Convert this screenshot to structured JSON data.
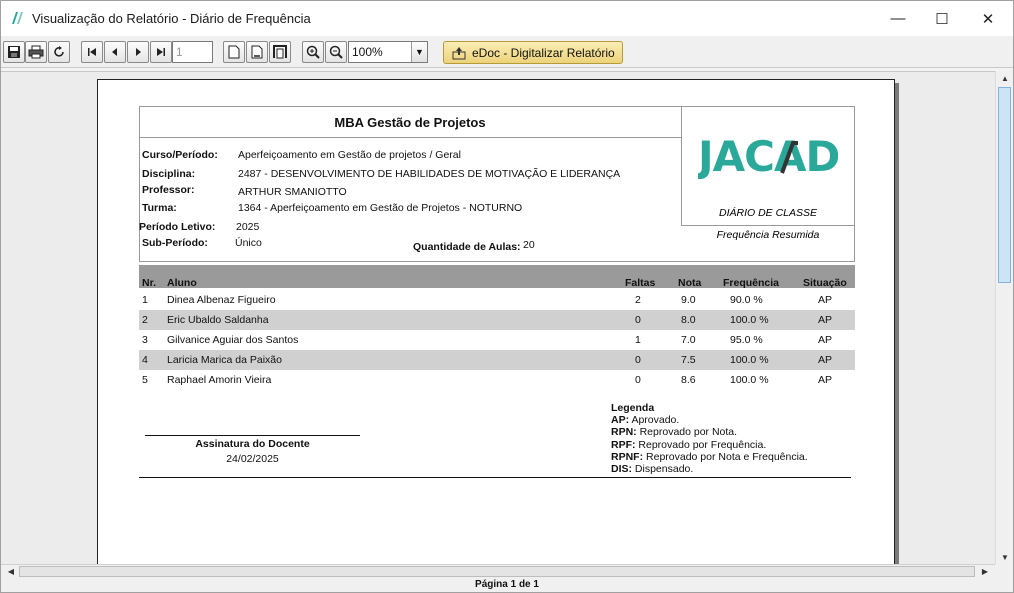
{
  "window": {
    "title": "Visualização do Relatório - Diário de Frequência",
    "min_glyph": "—",
    "max_glyph": "☐",
    "close_glyph": "✕"
  },
  "toolbar": {
    "page_value": "1",
    "zoom_value": "100%",
    "edoc_label": "eDoc - Digitalizar Relatório"
  },
  "report": {
    "course_title": "MBA Gestão de Projetos",
    "logo_text": "JACAD",
    "diario_label": "DIÁRIO DE CLASSE",
    "resumida_label": "Frequência Resumida",
    "fields": {
      "curso_label": "Curso/Período:",
      "curso_value": "Aperfeiçoamento em Gestão de projetos / Geral",
      "disciplina_label": "Disciplina:",
      "disciplina_value": "2487 - DESENVOLVIMENTO DE HABILIDADES DE MOTIVAÇÃO E LIDERANÇA",
      "professor_label": "Professor:",
      "professor_value": "ARTHUR SMANIOTTO",
      "turma_label": "Turma:",
      "turma_value": "1364 - Aperfeiçoamento em Gestão de Projetos - NOTURNO",
      "periodo_label": "Período Letivo:",
      "periodo_value": "2025",
      "subperiodo_label": "Sub-Período:",
      "subperiodo_value": "Único",
      "aulas_label": "Quantidade de Aulas:",
      "aulas_value": "20"
    },
    "columns": {
      "nr": "Nr.",
      "aluno": "Aluno",
      "faltas": "Faltas",
      "nota": "Nota",
      "frequencia": "Frequência",
      "situacao": "Situação"
    },
    "rows": [
      {
        "nr": "1",
        "aluno": "Dinea Albenaz Figueiro",
        "faltas": "2",
        "nota": "9.0",
        "frequencia": "90.0 %",
        "situacao": "AP"
      },
      {
        "nr": "2",
        "aluno": "Eric Ubaldo Saldanha",
        "faltas": "0",
        "nota": "8.0",
        "frequencia": "100.0 %",
        "situacao": "AP"
      },
      {
        "nr": "3",
        "aluno": "Gilvanice Aguiar dos Santos",
        "faltas": "1",
        "nota": "7.0",
        "frequencia": "95.0 %",
        "situacao": "AP"
      },
      {
        "nr": "4",
        "aluno": "Laricia Marica da Paixão",
        "faltas": "0",
        "nota": "7.5",
        "frequencia": "100.0 %",
        "situacao": "AP"
      },
      {
        "nr": "5",
        "aluno": "Raphael Amorin Vieira",
        "faltas": "0",
        "nota": "8.6",
        "frequencia": "100.0 %",
        "situacao": "AP"
      }
    ],
    "signature": {
      "label": "Assinatura do Docente",
      "date": "24/02/2025"
    },
    "legend": {
      "title": "Legenda",
      "items": [
        {
          "code": "AP:",
          "text": "Aprovado."
        },
        {
          "code": "RPN:",
          "text": "Reprovado por Nota."
        },
        {
          "code": "RPF:",
          "text": "Reprovado por Frequência."
        },
        {
          "code": "RPNF:",
          "text": "Reprovado por Nota e Frequência."
        },
        {
          "code": "DIS:",
          "text": "Dispensado."
        }
      ]
    }
  },
  "status": {
    "page_info": "Página 1 de 1"
  }
}
